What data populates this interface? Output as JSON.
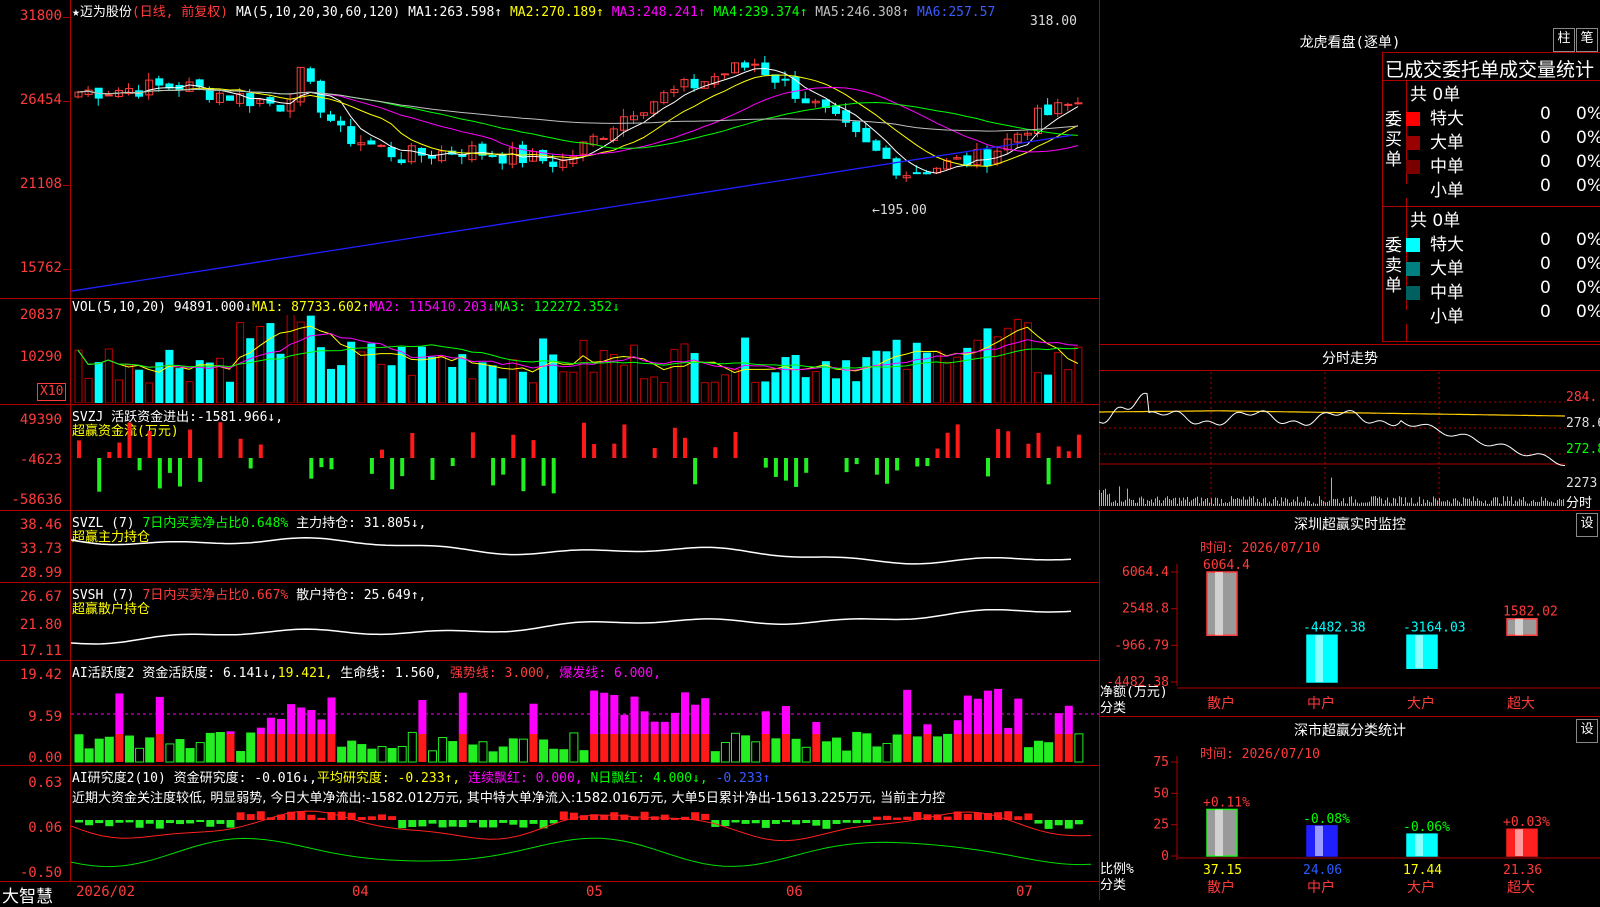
{
  "main_chart": {
    "title": "★迈为股份",
    "mode": "(日线, 前复权)",
    "ma_label": "MA(5,10,20,30,60,120)",
    "ma": [
      {
        "name": "MA1:",
        "value": "263.598↑",
        "color": "#ffffff"
      },
      {
        "name": "MA2:",
        "value": "270.189↑",
        "color": "#ffff00"
      },
      {
        "name": "MA3:",
        "value": "248.241↑",
        "color": "#ff00ff"
      },
      {
        "name": "MA4:",
        "value": "239.374↑",
        "color": "#00ff00"
      },
      {
        "name": "MA5:",
        "value": "246.308↑",
        "color": "#c0c0c0"
      },
      {
        "name": "MA6:",
        "value": "257.57",
        "color": "#0000ff"
      }
    ],
    "y_ticks": [
      "31800",
      "26454",
      "21108",
      "15762"
    ],
    "high_label": "318.00",
    "low_label": "←195.00"
  },
  "volume": {
    "header": "VOL(5,10,20)",
    "value": "94891.000↓",
    "ma1": "MA1: 87733.602↑",
    "ma2": "MA2: 115410.203↓",
    "ma3": "MA3: 122272.352↓",
    "y_ticks": [
      "20837",
      "10290"
    ],
    "unit": "X10"
  },
  "svzj": {
    "header": "SVZJ",
    "label": "活跃资金进出:",
    "value": "-1581.966↓,",
    "sub": "超赢资金流(万元)",
    "y_ticks": [
      "49390",
      "-4623",
      "-58636"
    ]
  },
  "svzl": {
    "header": "SVZL (7)",
    "ratio": "7日内买卖净占比0.648%",
    "hold": "主力持仓: 31.805↓,",
    "sub": "超赢主力持仓",
    "y_ticks": [
      "38.46",
      "33.73",
      "28.99"
    ]
  },
  "svsh": {
    "header": "SVSH (7)",
    "ratio": "7日内买卖净占比0.667%",
    "hold": "散户持仓: 25.649↑,",
    "sub": "超赢散户持仓",
    "y_ticks": [
      "26.67",
      "21.80",
      "17.11"
    ]
  },
  "ai_active": {
    "header": "AI活跃度2",
    "a": "资金活跃度: 6.141↓,",
    "b": "19.421,",
    "c": "生命线: 1.560,",
    "d": "强势线: 3.000,",
    "e": "爆发线: 6.000,",
    "y_ticks": [
      "19.42",
      "9.59",
      "0.00"
    ]
  },
  "ai_research": {
    "header": "AI研究度2(10)",
    "a": "资金研究度: -0.016↓,",
    "b": "平均研究度: -0.233↑,",
    "c": "连续飘红: 0.000,",
    "d": "N日飘红: 4.000↓,",
    "e": "-0.233↑",
    "comment": "近期大资金关注度较低, 明显弱势, 今日大单净流出:-1582.012万元, 其中特大单净流入:1582.016万元, 大单5日累计净出-15613.225万元, 当前主力控",
    "y_ticks": [
      "0.63",
      "0.06",
      "-0.50"
    ]
  },
  "x_axis": {
    "brand": "大智慧",
    "labels": [
      "2026/02",
      "04",
      "05",
      "06",
      "07"
    ]
  },
  "dragon_tiger": {
    "title": "龙虎看盘(逐单)",
    "btn_bar": "柱",
    "btn_pen": "笔",
    "tabs_text": "已成交委托单成交量统计",
    "buy": {
      "side_label": "委买单",
      "total": "共 0单",
      "rows": [
        {
          "label": "特大",
          "count": "0",
          "pct": "0%",
          "color": "#ff0000"
        },
        {
          "label": "大单",
          "count": "0",
          "pct": "0%",
          "color": "#990000"
        },
        {
          "label": "中单",
          "count": "0",
          "pct": "0%",
          "color": "#7a0000"
        },
        {
          "label": "小单",
          "count": "0",
          "pct": "0%",
          "color": "#000000"
        }
      ]
    },
    "sell": {
      "side_label": "委卖单",
      "total": "共 0单",
      "rows": [
        {
          "label": "特大",
          "count": "0",
          "pct": "0%",
          "color": "#00ffff"
        },
        {
          "label": "大单",
          "count": "0",
          "pct": "0%",
          "color": "#008080"
        },
        {
          "label": "中单",
          "count": "0",
          "pct": "0%",
          "color": "#006060"
        },
        {
          "label": "小单",
          "count": "0",
          "pct": "0%",
          "color": "#000000"
        }
      ]
    }
  },
  "intraday": {
    "title": "分时走势",
    "y_ticks": [
      "284.",
      "278.6",
      "272.8",
      "2273"
    ],
    "footer": "分时"
  },
  "sz_monitor": {
    "title": "深圳超赢实时监控",
    "btn": "设",
    "time": "时间: 2026/07/10",
    "y_ticks": [
      "6064.4",
      "2548.8",
      "-966.79",
      "-4482.38"
    ],
    "ylabel": "净额(万元)",
    "xlabel": "分类",
    "categories": [
      "散户",
      "中户",
      "大户",
      "超大"
    ],
    "values": [
      "6064.4",
      "-4482.38",
      "-3164.03",
      "1582.02"
    ]
  },
  "sz_stats": {
    "title": "深市超赢分类统计",
    "btn": "设",
    "time": "时间: 2026/07/10",
    "y_ticks": [
      "75",
      "50",
      "25",
      "0"
    ],
    "ylabel": "比例%",
    "xlabel": "分类",
    "categories": [
      "散户",
      "中户",
      "大户",
      "超大"
    ],
    "values": [
      "37.15",
      "24.06",
      "17.44",
      "21.36"
    ],
    "changes": [
      "+0.11%",
      "-0.08%",
      "-0.06%",
      "+0.03%"
    ]
  },
  "chart_data": [
    {
      "type": "bar",
      "title": "深圳超赢实时监控",
      "categories": [
        "散户",
        "中户",
        "大户",
        "超大"
      ],
      "values": [
        6064.4,
        -4482.38,
        -3164.03,
        1582.02
      ],
      "ylabel": "净额(万元)",
      "xlabel": "分类",
      "ylim": [
        -4482.38,
        6064.4
      ]
    },
    {
      "type": "bar",
      "title": "深市超赢分类统计",
      "categories": [
        "散户",
        "中户",
        "大户",
        "超大"
      ],
      "values": [
        37.15,
        24.06,
        17.44,
        21.36
      ],
      "ylabel": "比例%",
      "xlabel": "分类",
      "ylim": [
        0,
        75
      ]
    }
  ]
}
